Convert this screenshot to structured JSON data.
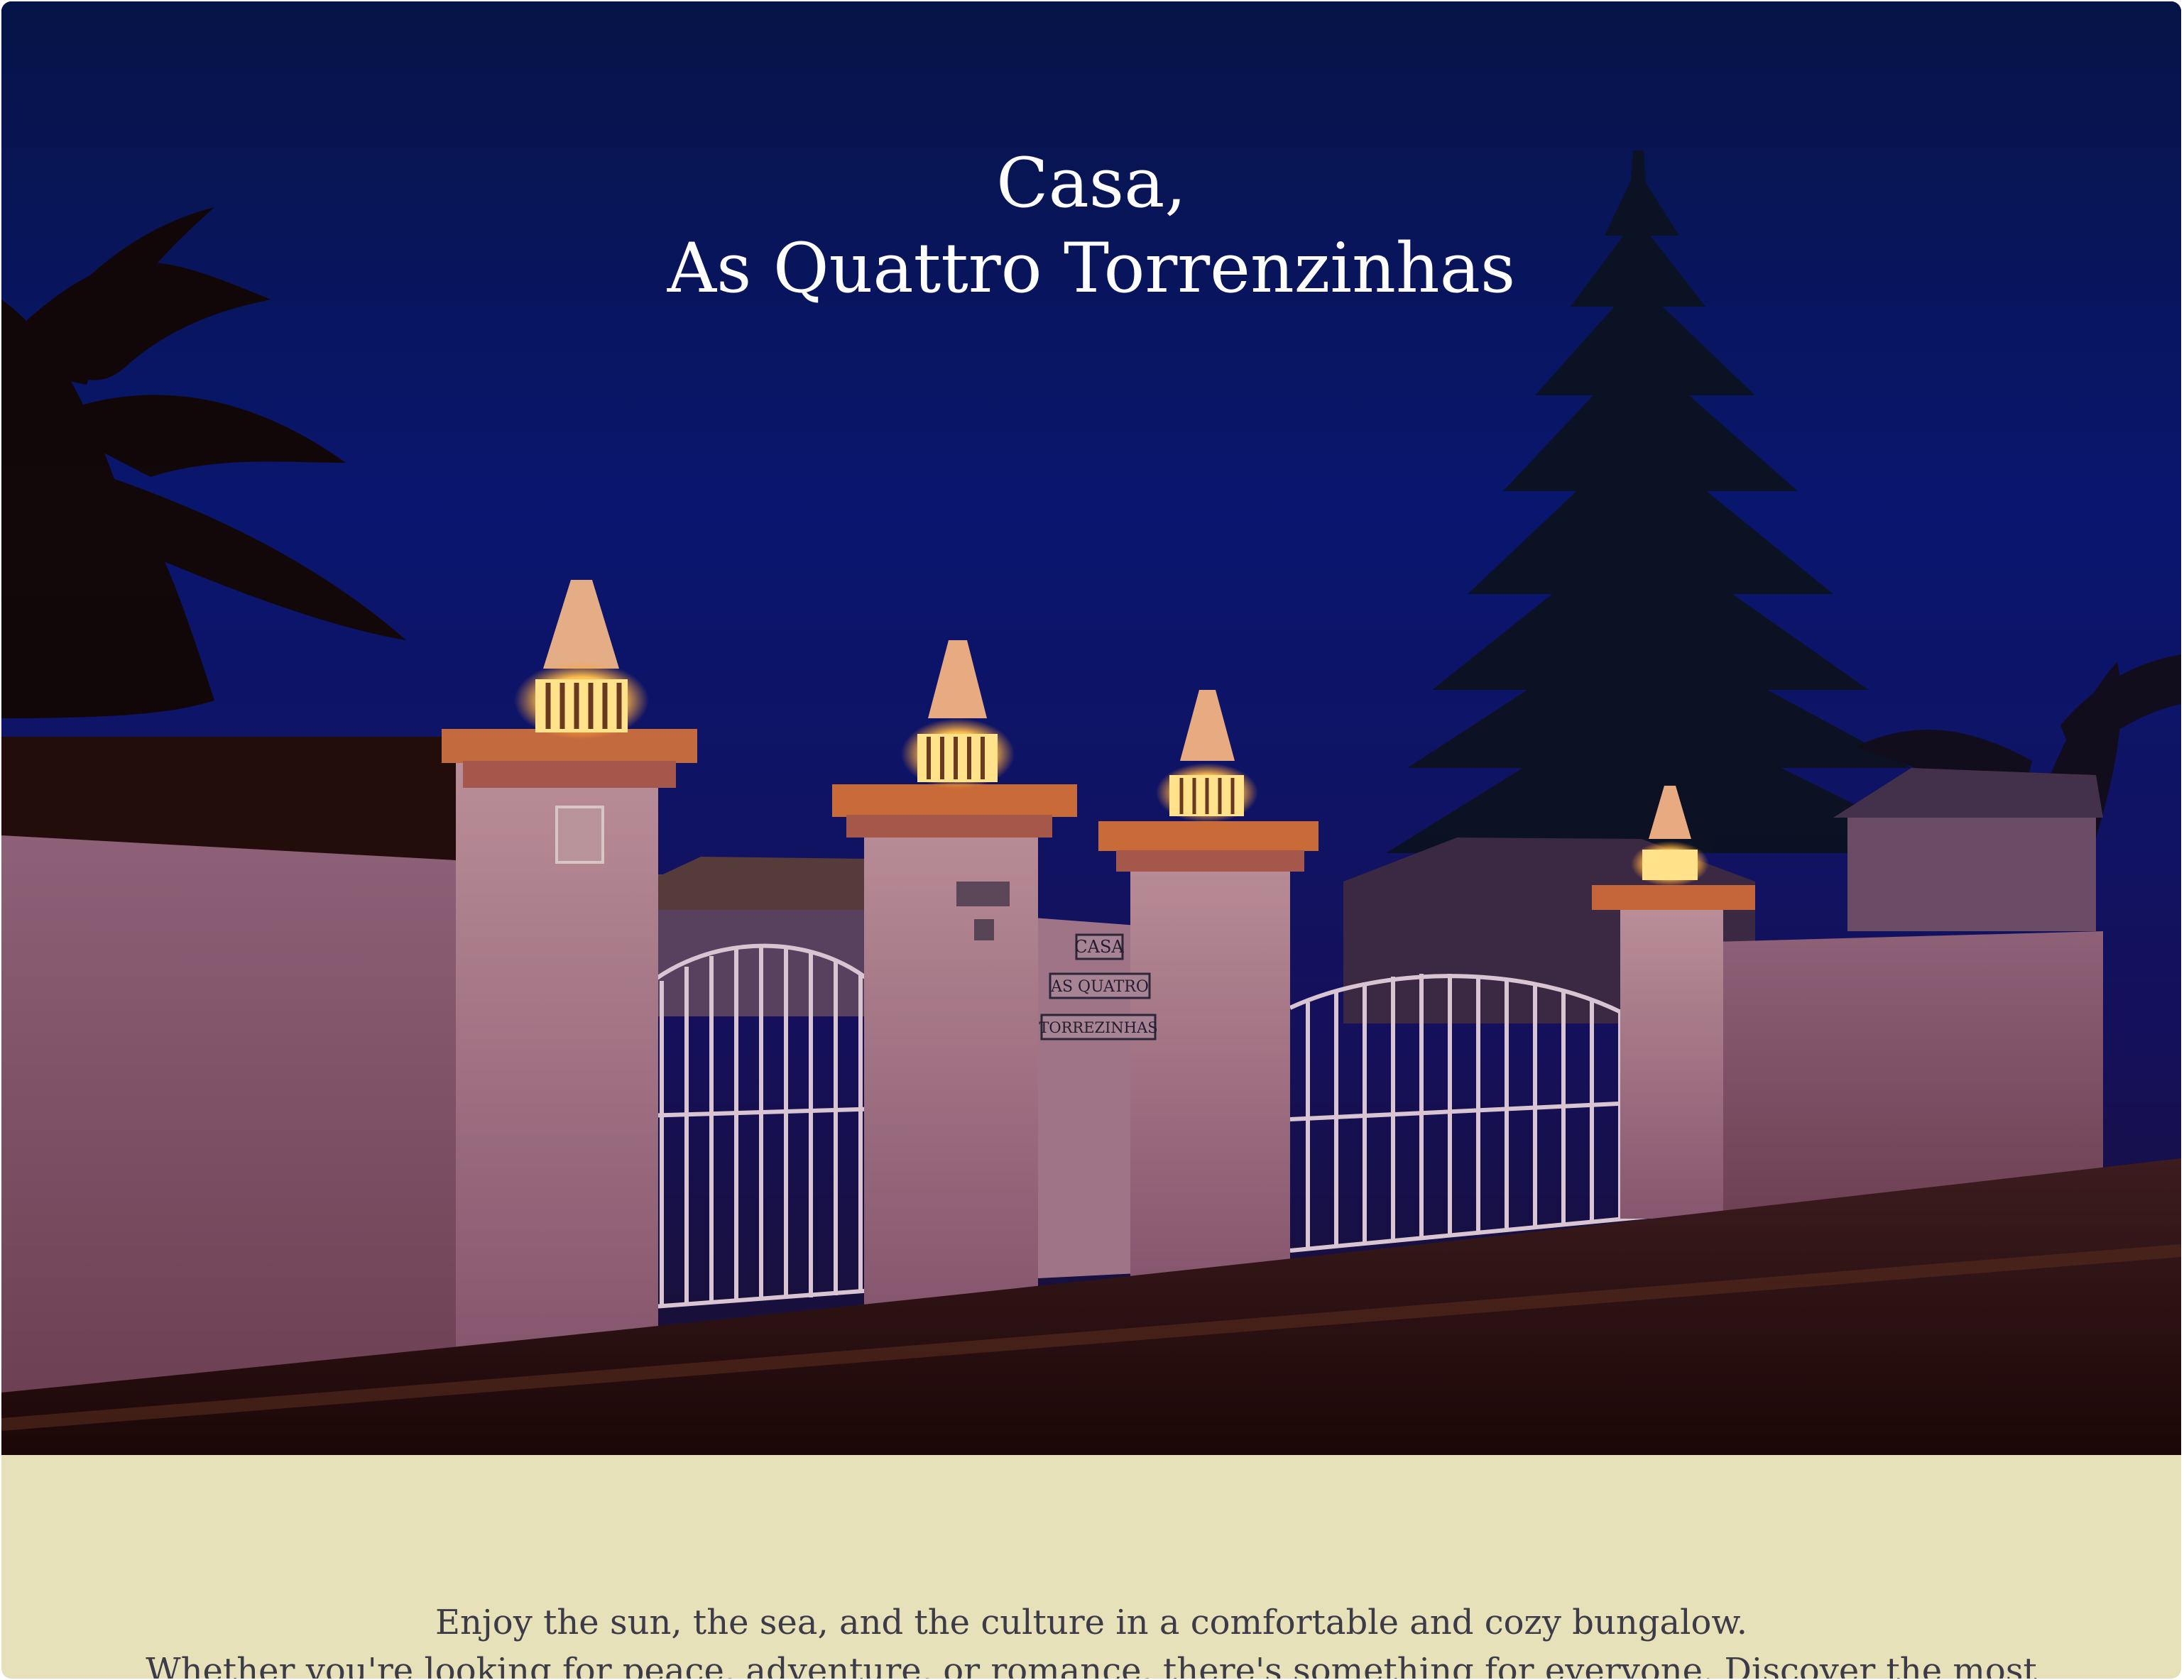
{
  "hero": {
    "title_line1": "Casa,",
    "title_line2": "As Quattro Torrenzinhas",
    "sign_lines": [
      "CASA",
      "AS QUATRO",
      "TORREZINHAS"
    ]
  },
  "intro": {
    "line1": "Enjoy the sun, the sea, and the culture in a comfortable and cozy bungalow.",
    "line2": "Whether you're looking for peace, adventure, or romance, there's something for everyone. Discover the most"
  },
  "colors": {
    "sky": "#0a1259",
    "wall": "#8e6178",
    "intro_background": "#e7e1b9",
    "intro_text": "#3c3b48",
    "lantern_glow": "#ffd36a"
  }
}
